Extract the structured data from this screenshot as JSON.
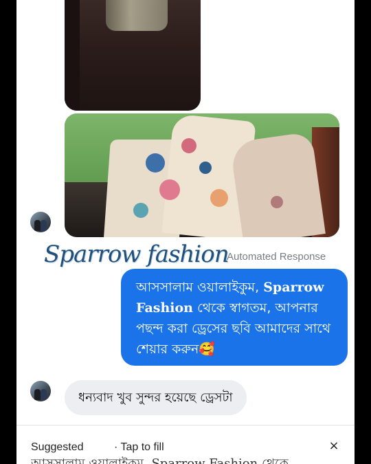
{
  "chat": {
    "brand_name": "Sparrow fashion",
    "auto_tag": "Automated Response",
    "outgoing": {
      "text_part1": "আসসালাম ওয়ালাইকুম, ",
      "brand": "Sparrow Fashion",
      "text_part2": " থেকে স্বাগতম, আপনার পছন্দ করা ড্রেসের ছবি আমাদের সাথে শেয়ার করুন🥰"
    },
    "incoming_reply": "ধন্যবাদ খুব সুন্দর হয়েছে ড্রেসটা"
  },
  "suggestion_bar": {
    "label": "Suggested",
    "hint": "· Tap to fill",
    "close_glyph": "×",
    "preview": "আসসালাম ওয়ালাইকুম, Sparrow Fashion থেকে"
  },
  "colors": {
    "outgoing_bubble": "#1a73e8",
    "incoming_bubble": "#eceef1",
    "brand_text": "#1f4f7a"
  }
}
